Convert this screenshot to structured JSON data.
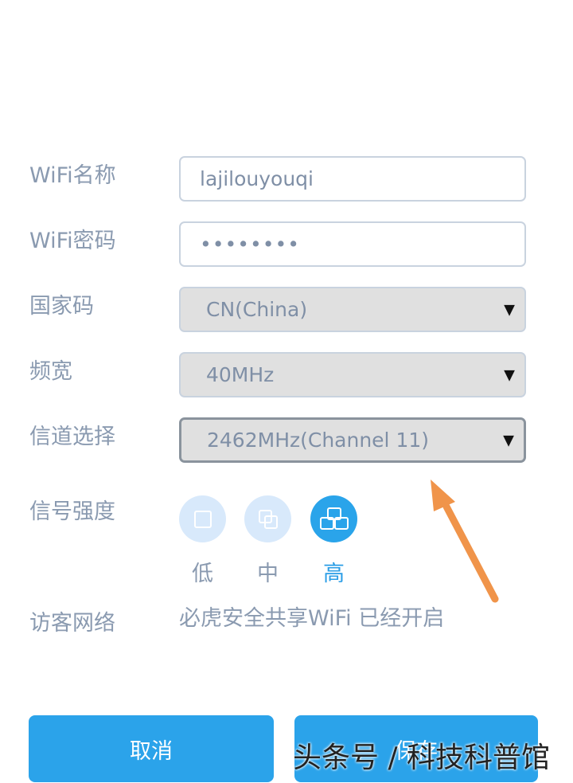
{
  "form": {
    "wifi_name": {
      "label": "WiFi名称",
      "value": "lajilouyouqi"
    },
    "wifi_password": {
      "label": "WiFi密码",
      "value": "••••••••"
    },
    "country_code": {
      "label": "国家码",
      "value": "CN(China)"
    },
    "bandwidth": {
      "label": "频宽",
      "value": "40MHz"
    },
    "channel": {
      "label": "信道选择",
      "value": "2462MHz(Channel 11)"
    },
    "caret": "▼",
    "signal_strength": {
      "label": "信号强度",
      "options": [
        {
          "label": "低",
          "icon": "single-square-icon"
        },
        {
          "label": "中",
          "icon": "overlap-squares-icon"
        },
        {
          "label": "高",
          "icon": "triple-squares-icon"
        }
      ],
      "selected": "高"
    },
    "guest_network": {
      "label": "访客网络",
      "value": "必虎安全共享WiFi 已经开启"
    }
  },
  "buttons": {
    "cancel": "取消",
    "save": "保存"
  },
  "watermark": "头条号 / 科技科普馆",
  "colors": {
    "accent": "#2ba3ea",
    "annotation_arrow": "#f0944a",
    "label": "#8a9ab0"
  }
}
